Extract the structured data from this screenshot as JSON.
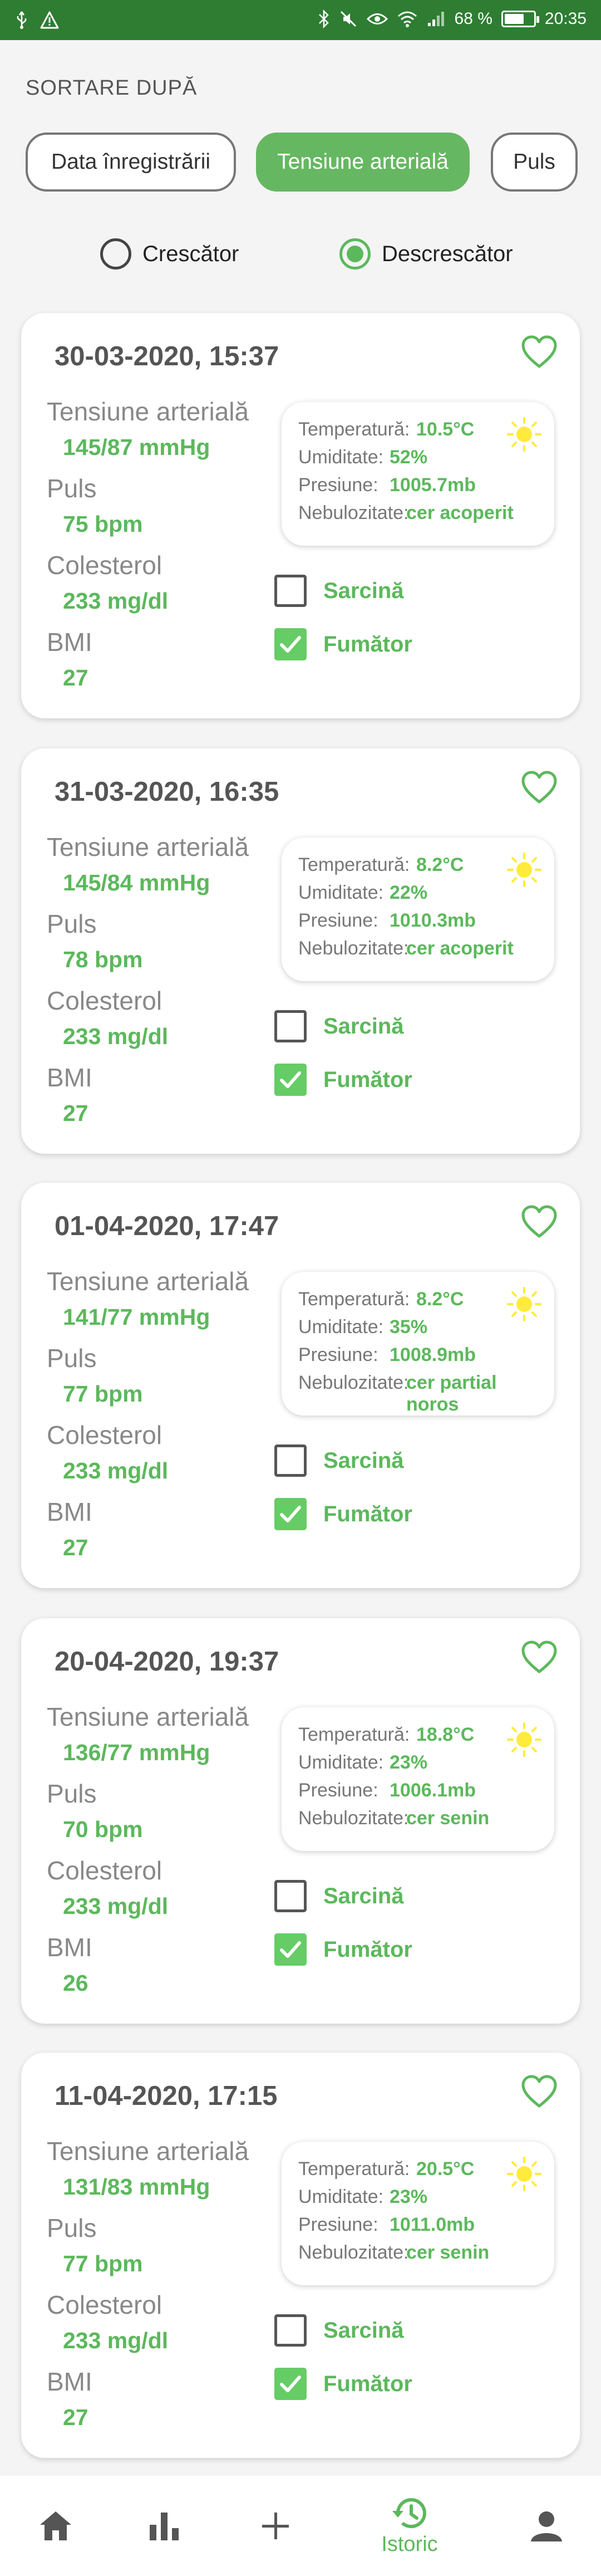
{
  "status_bar": {
    "battery": "68 %",
    "battery_level": 0.68,
    "time": "20:35"
  },
  "sort": {
    "title": "SORTARE DUPĂ",
    "options": [
      "Data înregistrării",
      "Tensiune arterială",
      "Puls"
    ],
    "active_option": "Tensiune arterială",
    "order": {
      "asc": "Crescător",
      "desc": "Descrescător",
      "selected": "Descrescător"
    }
  },
  "labels": {
    "tension": "Tensiune arterială",
    "pulse": "Puls",
    "cholesterol": "Colesterol",
    "bmi": "BMI",
    "temperature": "Temperatură:",
    "humidity": "Umiditate:",
    "pressure": "Presiune:",
    "clouds": "Nebulozitate:",
    "pregnancy": "Sarcină",
    "smoker": "Fumător"
  },
  "records": [
    {
      "date": "30-03-2020, 15:37",
      "tension": "145/87 mmHg",
      "pulse": "75 bpm",
      "cholesterol": "233 mg/dl",
      "bmi": "27",
      "temperature": "10.5°C",
      "humidity": "52%",
      "pressure": "1005.7mb",
      "clouds": "cer acoperit",
      "clouds_2": "",
      "pregnancy": false,
      "smoker": true
    },
    {
      "date": "31-03-2020, 16:35",
      "tension": "145/84 mmHg",
      "pulse": "78 bpm",
      "cholesterol": "233 mg/dl",
      "bmi": "27",
      "temperature": "8.2°C",
      "humidity": "22%",
      "pressure": "1010.3mb",
      "clouds": "cer acoperit",
      "clouds_2": "",
      "pregnancy": false,
      "smoker": true
    },
    {
      "date": "01-04-2020, 17:47",
      "tension": "141/77 mmHg",
      "pulse": "77 bpm",
      "cholesterol": "233 mg/dl",
      "bmi": "27",
      "temperature": "8.2°C",
      "humidity": "35%",
      "pressure": "1008.9mb",
      "clouds": "cer partial",
      "clouds_2": "noros",
      "pregnancy": false,
      "smoker": true
    },
    {
      "date": "20-04-2020, 19:37",
      "tension": "136/77 mmHg",
      "pulse": "70 bpm",
      "cholesterol": "233 mg/dl",
      "bmi": "26",
      "temperature": "18.8°C",
      "humidity": "23%",
      "pressure": "1006.1mb",
      "clouds": "cer senin",
      "clouds_2": "",
      "pregnancy": false,
      "smoker": true
    },
    {
      "date": "11-04-2020, 17:15",
      "tension": "131/83 mmHg",
      "pulse": "77 bpm",
      "cholesterol": "233 mg/dl",
      "bmi": "27",
      "temperature": "20.5°C",
      "humidity": "23%",
      "pressure": "1011.0mb",
      "clouds": "cer senin",
      "clouds_2": "",
      "pregnancy": false,
      "smoker": true
    }
  ],
  "bottom_nav": {
    "active_label": "Istoric"
  },
  "colors": {
    "accent": "#5cb85c",
    "status_bar": "#2e7d32"
  }
}
